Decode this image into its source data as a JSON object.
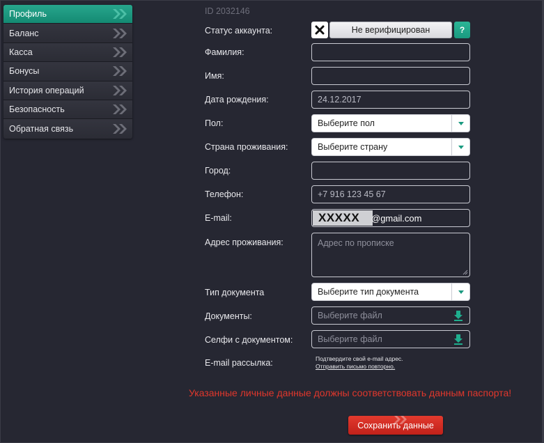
{
  "sidebar": {
    "items": [
      {
        "label": "Профиль",
        "active": true
      },
      {
        "label": "Баланс"
      },
      {
        "label": "Касса"
      },
      {
        "label": "Бонусы"
      },
      {
        "label": "История операций"
      },
      {
        "label": "Безопасность"
      },
      {
        "label": "Обратная связь"
      }
    ]
  },
  "form": {
    "id_text": "ID 2032146",
    "status": {
      "label": "Статус аккаунта:",
      "value": "Не верифицирован",
      "help": "?"
    },
    "surname": {
      "label": "Фамилия:",
      "value": ""
    },
    "name": {
      "label": "Имя:",
      "value": ""
    },
    "birth": {
      "label": "Дата рождения:",
      "value": "24.12.2017"
    },
    "gender": {
      "label": "Пол:",
      "value": "Выберите пол"
    },
    "country": {
      "label": "Страна проживания:",
      "value": "Выберите страну"
    },
    "city": {
      "label": "Город:",
      "value": ""
    },
    "phone": {
      "label": "Телефон:",
      "value": "+7 916 123 45 67"
    },
    "email": {
      "label": "E-mail:",
      "masked": "XXXXX",
      "domain": "@gmail.com"
    },
    "address": {
      "label": "Адрес проживания:",
      "placeholder": "Адрес по прописке"
    },
    "doc_type": {
      "label": "Тип документа",
      "value": "Выберите тип документа"
    },
    "documents": {
      "label": "Документы:",
      "placeholder": "Выберите файл"
    },
    "selfie": {
      "label": "Селфи с документом:",
      "placeholder": "Выберите файл"
    },
    "newsletter": {
      "label": "E-mail рассылка:",
      "note": "Подтвердите свой e-mail адрес.",
      "link": "Отправить письмо повторно."
    },
    "warning": "Указанные личные данные должны соответствовать данным паспорта!",
    "save_label": "Сохранить данные"
  },
  "colors": {
    "accent": "#1a9a80",
    "background": "#262732",
    "warning": "#e0372c",
    "save_button": "#d42c22"
  }
}
